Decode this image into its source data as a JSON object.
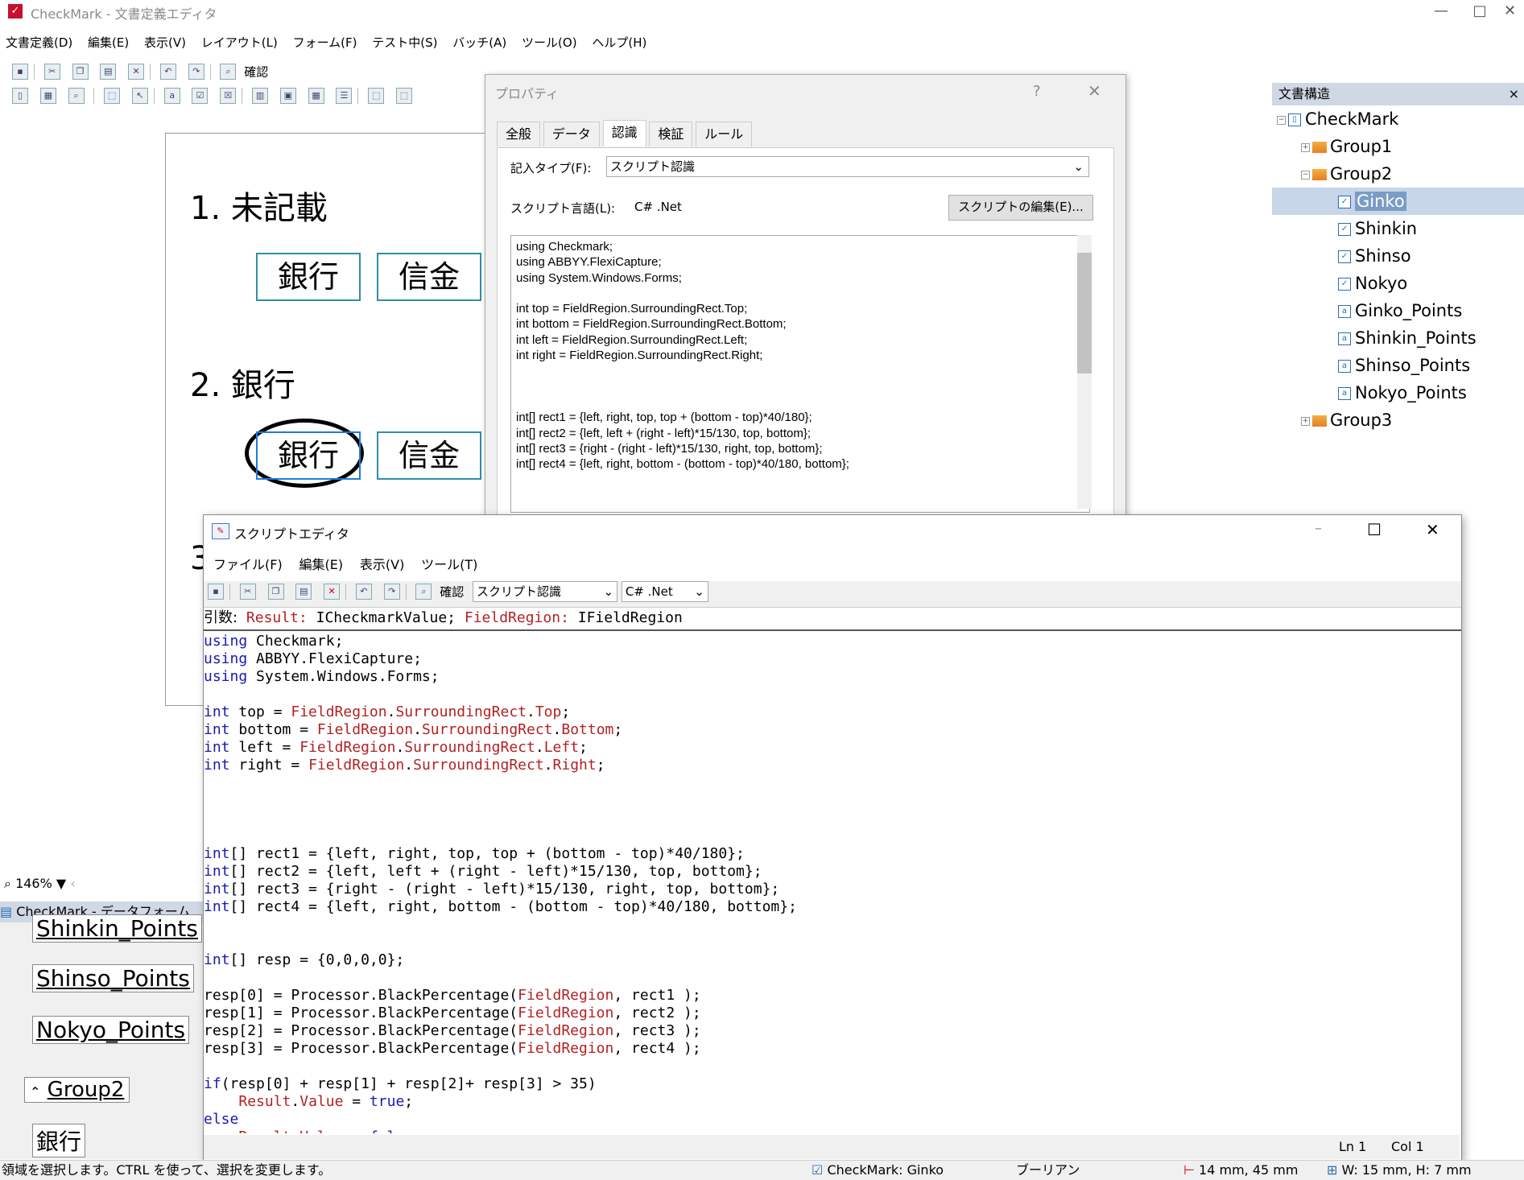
{
  "app": {
    "title": "CheckMark - 文書定義エディタ",
    "menu": [
      "文書定義(D)",
      "編集(E)",
      "表示(V)",
      "レイアウト(L)",
      "フォーム(F)",
      "テスト中(S)",
      "バッチ(A)",
      "ツール(O)",
      "ヘルプ(H)"
    ],
    "toolbar_confirm": "確認",
    "zoom": "146%"
  },
  "canvas": {
    "q1": "1. 未記載",
    "q2": "2. 銀行",
    "q3": "3",
    "box_bank": "銀行",
    "box_shinkin": "信金"
  },
  "properties": {
    "title": "プロパティ",
    "help": "?",
    "close": "✕",
    "tabs": [
      "全般",
      "データ",
      "認識",
      "検証",
      "ルール"
    ],
    "entry_type_label": "記入タイプ(F):",
    "entry_type_value": "スクリプト認識",
    "script_lang_label": "スクリプト言語(L):",
    "script_lang_value": "C# .Net",
    "edit_button": "スクリプトの編集(E)...",
    "code": "using Checkmark;\nusing ABBYY.FlexiCapture;\nusing System.Windows.Forms;\n\nint top = FieldRegion.SurroundingRect.Top;\nint bottom = FieldRegion.SurroundingRect.Bottom;\nint left = FieldRegion.SurroundingRect.Left;\nint right = FieldRegion.SurroundingRect.Right;\n\n\n\nint[] rect1 = {left, right, top, top + (bottom - top)*40/180};\nint[] rect2 = {left, left + (right - left)*15/130, top, bottom};\nint[] rect3 = {right - (right - left)*15/130, right, top, bottom};\nint[] rect4 = {left, right, bottom - (bottom - top)*40/180, bottom};"
  },
  "structure": {
    "header": "文書構造",
    "close": "×",
    "root": "CheckMark",
    "group1": "Group1",
    "group2": "Group2",
    "group3": "Group3",
    "items": [
      "Ginko",
      "Shinkin",
      "Shinso",
      "Nokyo",
      "Ginko_Points",
      "Shinkin_Points",
      "Shinso_Points",
      "Nokyo_Points"
    ]
  },
  "dataform": {
    "header": "CheckMark - データフォーム",
    "labels": [
      "Shinkin_Points",
      "Shinso_Points",
      "Nokyo_Points"
    ],
    "group": "Group2",
    "bank": "銀行"
  },
  "script_editor": {
    "title": "スクリプトエディタ",
    "menu": [
      "ファイル(F)",
      "編集(E)",
      "表示(V)",
      "ツール(T)"
    ],
    "confirm": "確認",
    "mode": "スクリプト認識",
    "lang": "C# .Net",
    "args_label": "引数:",
    "arg1_name": "Result:",
    "arg1_type": "ICheckmarkValue;",
    "arg2_name": "FieldRegion:",
    "arg2_type": "IFieldRegion",
    "ln": "Ln 1",
    "col": "Col 1"
  },
  "status": {
    "message": "領域を選択します。CTRL を使って、選択を変更します。",
    "field": "CheckMark: Ginko",
    "type": "ブーリアン",
    "position": "14 mm, 45 mm",
    "size": "W: 15 mm, H: 7 mm"
  }
}
